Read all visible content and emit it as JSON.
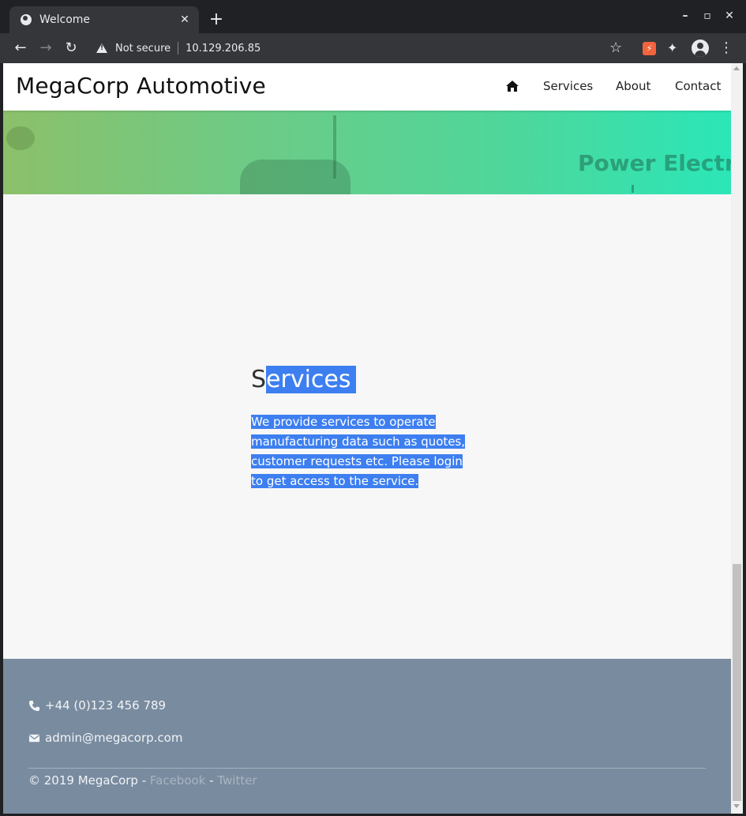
{
  "browser": {
    "tab_title": "Welcome",
    "tab_close": "✕",
    "new_tab": "+",
    "window_controls": {
      "minimize": "–",
      "maximize": "▫",
      "close": "✕"
    },
    "nav_back": "←",
    "nav_forward": "→",
    "nav_reload": "↻",
    "security_label": "Not secure",
    "url": "10.129.206.85",
    "bookmark_icon": "☆",
    "extension_badge": "⚡",
    "extensions_icon": "✦",
    "menu_icon": "⋮"
  },
  "navbar": {
    "brand": "MegaCorp Automotive",
    "home_icon": "home-icon",
    "links": [
      "Services",
      "About",
      "Contact"
    ]
  },
  "hero": {
    "caption": "Power Electron"
  },
  "main": {
    "services": {
      "heading_first": "S",
      "heading_rest": "ervices",
      "body": "We provide services to operate manufacturing data such as quotes, customer requests etc. Please login to get access to the service."
    },
    "selection_color": "#3d7ff0"
  },
  "footer": {
    "phone": "+44 (0)123 456 789",
    "email": "admin@megacorp.com",
    "copyright": "© 2019 MegaCorp - ",
    "separator": " - ",
    "link_facebook": "Facebook",
    "link_twitter": "Twitter",
    "background": "#798b9f"
  }
}
